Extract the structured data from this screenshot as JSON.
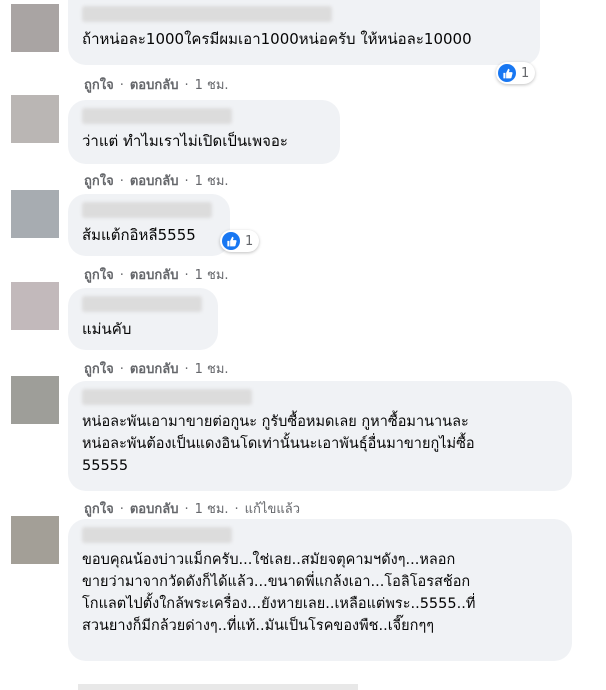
{
  "comments": [
    {
      "text": "ถ้าหน่อละ1000ใครมีผมเอา1000หน่อครับ ให้หน่อละ10000",
      "actions": {
        "like": "ถูกใจ",
        "reply": "ตอบกลับ",
        "time": "1 ชม."
      },
      "reactions": "1"
    },
    {
      "text": "ว่าแต่ ทำไมเราไม่เปิดเป็นเพจอะ",
      "actions": {
        "like": "ถูกใจ",
        "reply": "ตอบกลับ",
        "time": "1 ชม."
      }
    },
    {
      "text": "ส้มแต้กอิหลี5555",
      "actions": {
        "like": "ถูกใจ",
        "reply": "ตอบกลับ",
        "time": "1 ชม."
      },
      "reactions": "1"
    },
    {
      "text": "แม่นคับ",
      "actions": {
        "like": "ถูกใจ",
        "reply": "ตอบกลับ",
        "time": "1 ชม."
      }
    },
    {
      "text": "หน่อละพันเอามาขายต่อกูนะ กูรับซื้อหมดเลย กูหาซื้อมานานละ\nหน่อละพันต้องเป็นแดงอินโดเท่านั้นนะเอาพันธุ์อื่นมาขายกูไม่ซื้อ\n55555",
      "actions": {
        "like": "ถูกใจ",
        "reply": "ตอบกลับ",
        "time": "1 ชม.",
        "edited": "แก้ไขแล้ว"
      }
    },
    {
      "text": "ขอบคุณน้องบ่าวแม็กครับ...ใช่เลย..สมัยจตุคามฯดังๆ...หลอก\nขายว่ามาจากวัดดังก็ได้แล้ว...ขนาดพี่แกล้งเอา...โอลิโอรสช้อก\nโกแลตไปตั้งใกล้พระเครื่อง...ยังหายเลย..เหลือแต่พระ..5555..ที่\nสวนยางก็มีกล้วยด่างๆ..ที่แท้..มันเป็นโรคของพืช..เจี๊ยกๆๆ"
    }
  ],
  "colors": {
    "bubble": "#f0f2f5",
    "meta": "#65676b",
    "like_blue": "#1877f2"
  }
}
